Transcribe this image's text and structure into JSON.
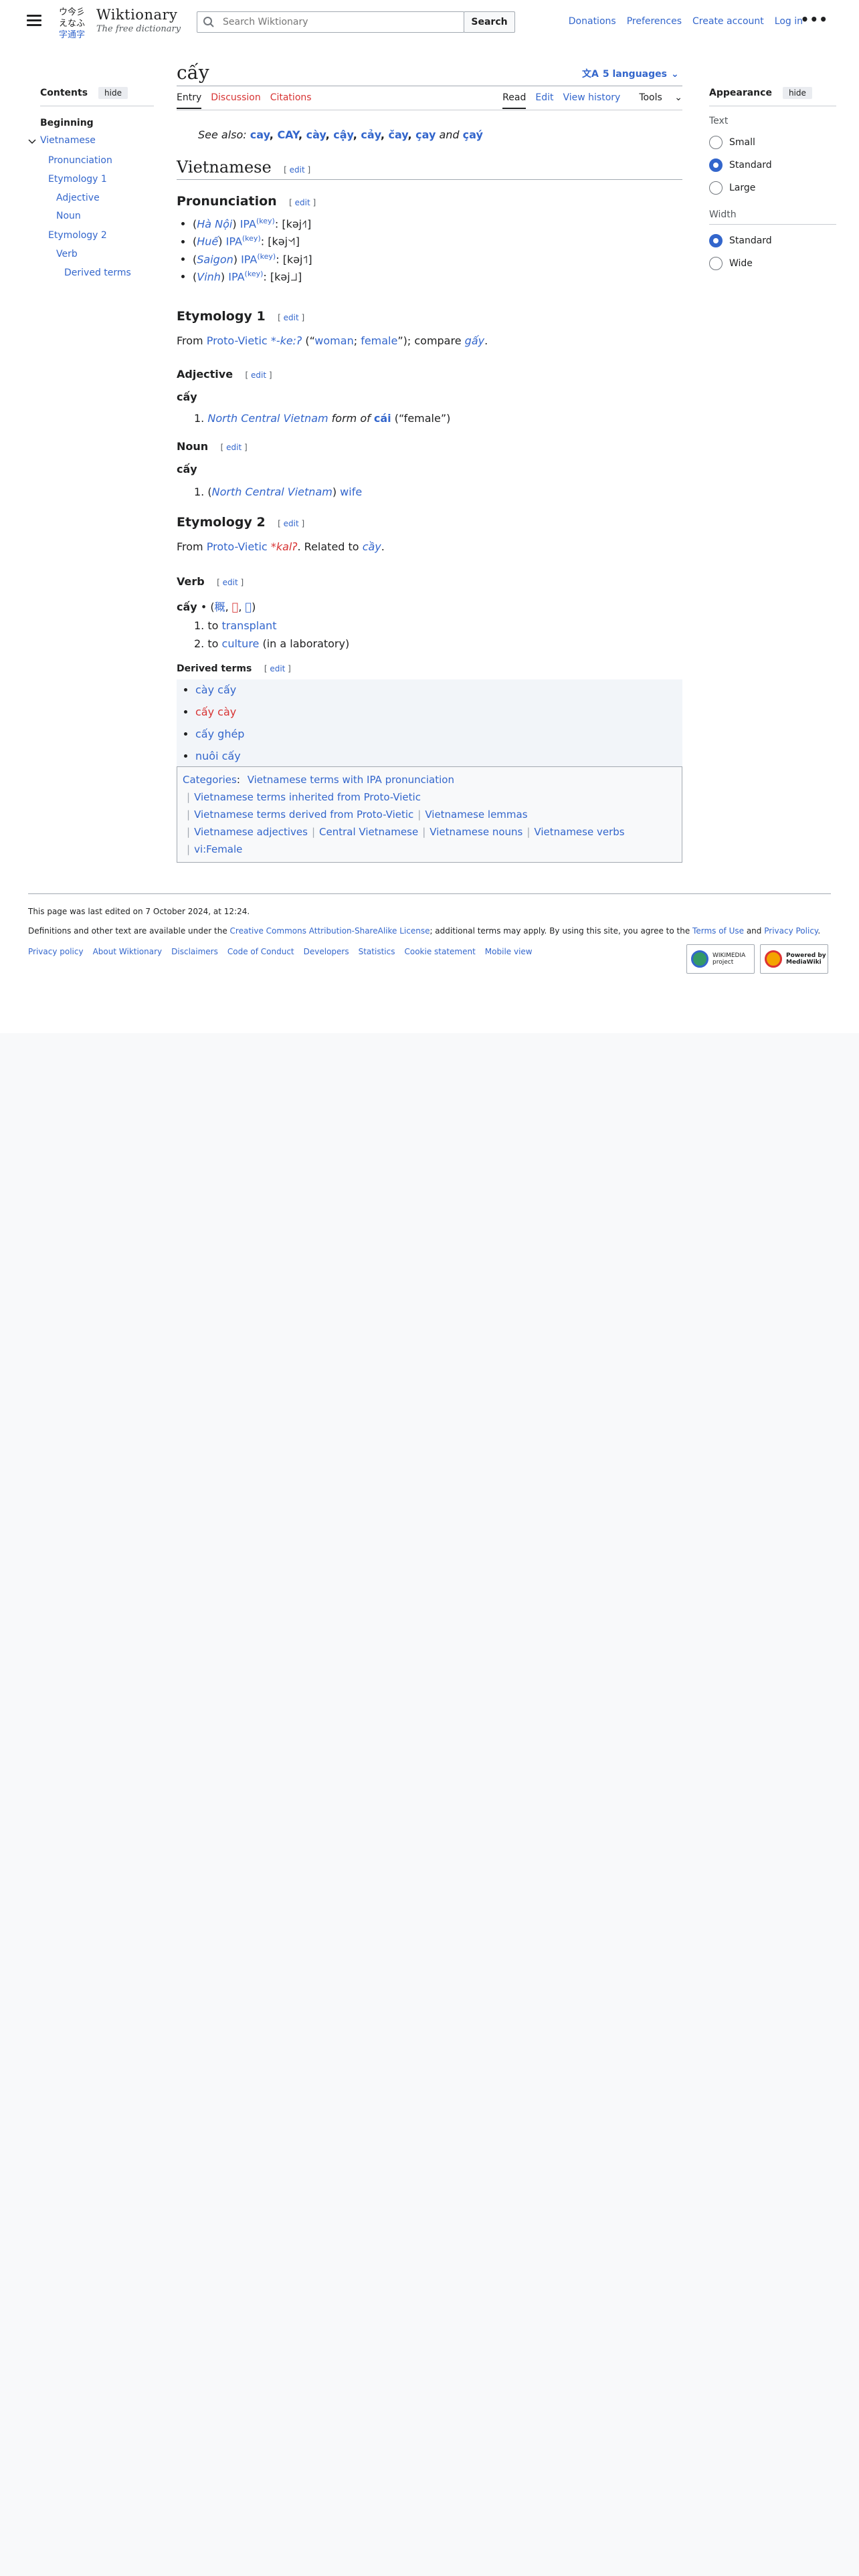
{
  "header": {
    "site_title": "Wiktionary",
    "site_tagline": "The free dictionary",
    "logo_glyphs": "ウ今彡　\nえなふ\n字通字",
    "search_placeholder": "Search Wiktionary",
    "search_button": "Search",
    "user_links": [
      "Donations",
      "Preferences",
      "Create account",
      "Log in"
    ],
    "more_icon": "ellipsis-icon"
  },
  "toc": {
    "title": "Contents",
    "hide_label": "hide",
    "items": [
      "Beginning",
      "Vietnamese",
      "Pronunciation",
      "Etymology 1",
      "Adjective",
      "Noun",
      "Etymology 2",
      "Verb",
      "Derived terms"
    ]
  },
  "page": {
    "title": "cấy",
    "languages_label": "5 languages",
    "tabs_left": [
      "Entry",
      "Discussion",
      "Citations"
    ],
    "tabs_right": [
      "Read",
      "Edit",
      "View history",
      "Tools"
    ],
    "see_also_prefix": "See also:",
    "see_also_items": [
      "cay",
      "CAY",
      "cày",
      "cậy",
      "cảy",
      "čay",
      "çay"
    ],
    "see_also_and": "and",
    "see_also_last": "çaý",
    "edit_label": "edit"
  },
  "vietnamese": {
    "heading": "Vietnamese",
    "pronunciation_heading": "Pronunciation",
    "pron": [
      {
        "dialect": "Hà Nội",
        "ipa_label": "IPA",
        "key": "(key)",
        "ipa": "[kəj˧˥]"
      },
      {
        "dialect": "Huế",
        "ipa_label": "IPA",
        "key": "(key)",
        "ipa": "[kəj˦˧˥]"
      },
      {
        "dialect": "Saigon",
        "ipa_label": "IPA",
        "key": "(key)",
        "ipa": "[kəj˦˥]"
      },
      {
        "dialect": "Vinh",
        "ipa_label": "IPA",
        "key": "(key)",
        "ipa": "[kəj˩˩]"
      }
    ],
    "ety1_heading": "Etymology 1",
    "ety1": {
      "from": "From",
      "proto": "Proto-Vietic",
      "reconstruction": "*-keːʔ",
      "gloss_open": " (“",
      "gloss1": "woman",
      "gloss_sep": "; ",
      "gloss2": "female",
      "gloss_close": "”); compare",
      "compare": "gấy",
      "end": "."
    },
    "adjective_heading": "Adjective",
    "adjective_headword": "cấy",
    "adjective_def": {
      "num": "1.",
      "region": "North Central Vietnam",
      "form_of": "form of",
      "lemma": "cái",
      "gloss": "(“female”)"
    },
    "noun_heading": "Noun",
    "noun_headword": "cấy",
    "noun_def": {
      "num": "1.",
      "region_open": "(",
      "region": "North Central Vietnam",
      "region_close": ")",
      "gloss": "wife"
    },
    "ety2_heading": "Etymology 2",
    "ety2": {
      "from": "From",
      "proto": "Proto-Vietic",
      "reconstruction": "*kalʔ",
      "related": ". Related to",
      "related_word": "cầy",
      "end": "."
    },
    "verb_heading": "Verb",
    "verb_headword": "cấy",
    "verb_bullet": "•",
    "verb_han": [
      "穊",
      "𦟚",
      "𠀧"
    ],
    "verb_defs": [
      {
        "num": "1.",
        "pre": "to",
        "link": "transplant",
        "post": ""
      },
      {
        "num": "2.",
        "pre": "to",
        "link": "culture",
        "post": "(in a laboratory)"
      }
    ],
    "derived_heading": "Derived terms",
    "derived": [
      {
        "text": "cày cấy",
        "red": false
      },
      {
        "text": "cấy cày",
        "red": true
      },
      {
        "text": "cấy ghép",
        "red": false
      },
      {
        "text": "nuôi cấy",
        "red": false
      }
    ]
  },
  "categories": {
    "label": "Categories",
    "items": [
      "Vietnamese terms with IPA pronunciation",
      "Vietnamese terms inherited from Proto-Vietic",
      "Vietnamese terms derived from Proto-Vietic",
      "Vietnamese lemmas",
      "Vietnamese adjectives",
      "Central Vietnamese",
      "Vietnamese nouns",
      "Vietnamese verbs",
      "vi:Female"
    ]
  },
  "appearance": {
    "title": "Appearance",
    "hide_label": "hide",
    "text_label": "Text",
    "text_options": [
      "Small",
      "Standard",
      "Large"
    ],
    "text_selected": "Standard",
    "width_label": "Width",
    "width_options": [
      "Standard",
      "Wide"
    ],
    "width_selected": "Standard"
  },
  "footer": {
    "last_edited": "This page was last edited on 7 October 2024, at 12:24.",
    "license_pre": "Definitions and other text are available under the",
    "license_link": "Creative Commons Attribution-ShareAlike License",
    "license_mid": "; additional terms may apply. By using this site, you agree to the",
    "terms_link": "Terms of Use",
    "and": "and",
    "privacy_link": "Privacy Policy",
    "end": ".",
    "links": [
      "Privacy policy",
      "About Wiktionary",
      "Disclaimers",
      "Code of Conduct",
      "Developers",
      "Statistics",
      "Cookie statement",
      "Mobile view"
    ],
    "wikimedia_badge": "WIKIMEDIA project",
    "mediawiki_badge": "Powered by MediaWiki"
  },
  "colors": {
    "link": "#3366cc",
    "redlink": "#d73333",
    "accent": "#3366cc"
  }
}
